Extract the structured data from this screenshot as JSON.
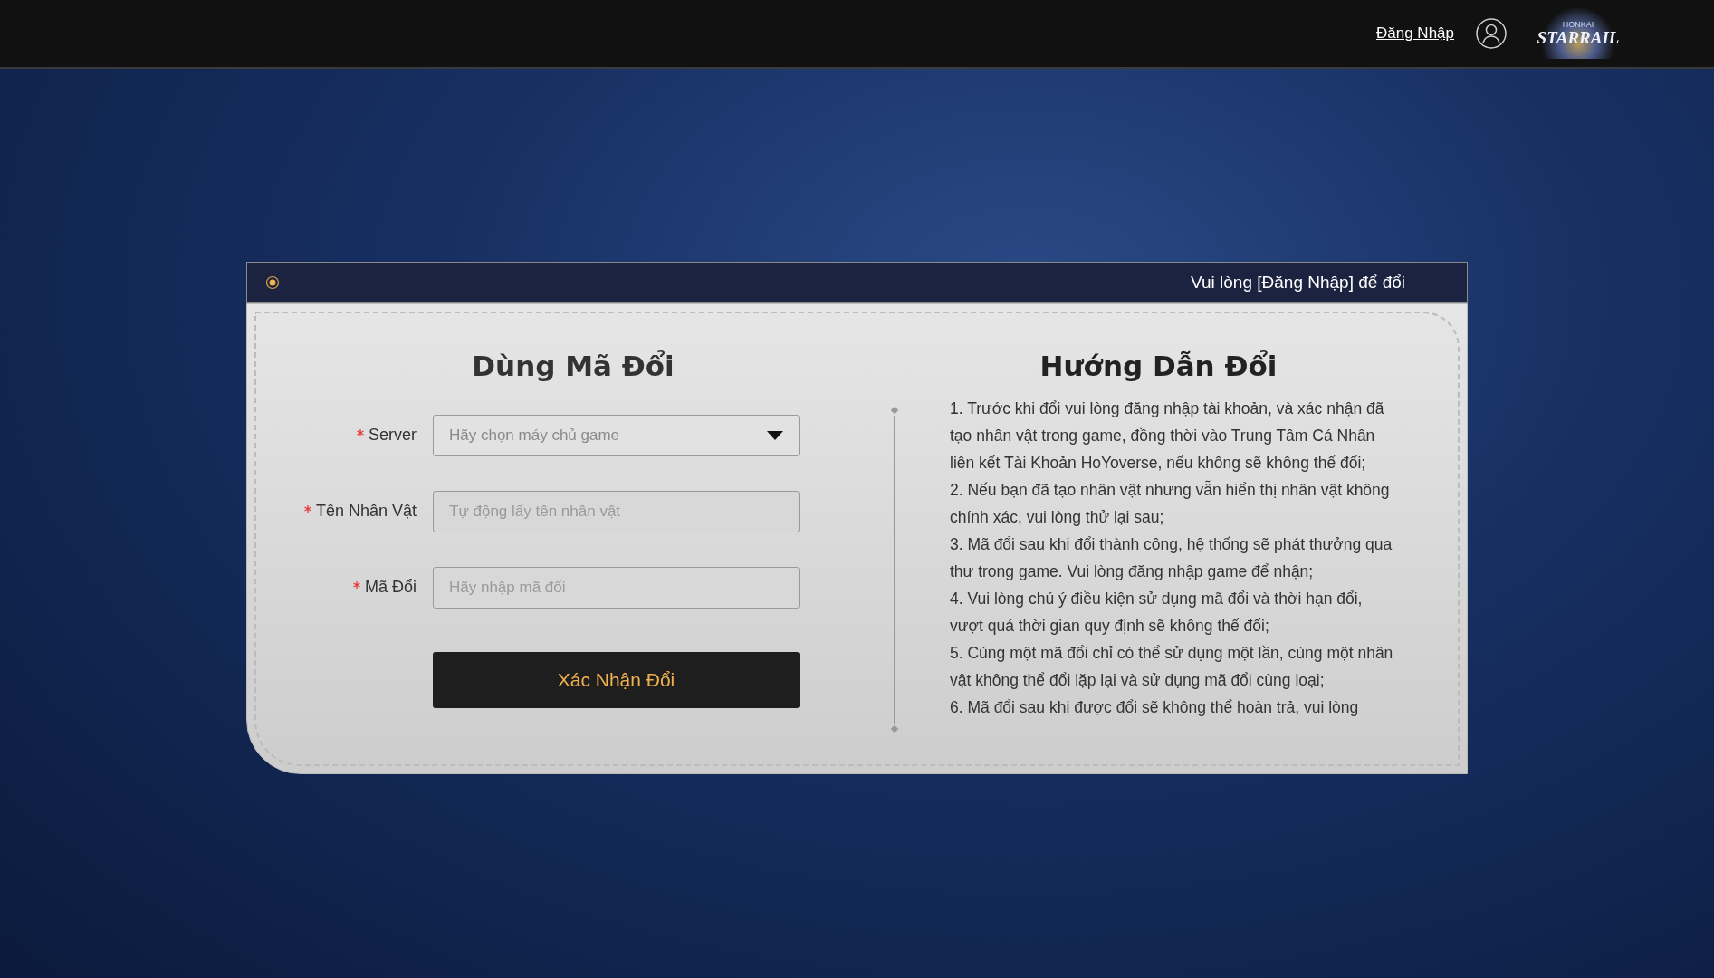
{
  "top_bar": {
    "login_link": "Đăng Nhập",
    "logo": {
      "small": "HONKAI",
      "main": "STARRAIL"
    }
  },
  "card": {
    "notice": "Vui lòng [Đăng Nhập] để đổi",
    "form": {
      "title": "Dùng Mã Đổi",
      "fields": [
        {
          "kind": "select",
          "label": "Server",
          "required": true,
          "placeholder": "Hãy chọn máy chủ game"
        },
        {
          "kind": "text",
          "label": "Tên Nhân Vật",
          "required": true,
          "placeholder": "Tự động lấy tên nhân vật"
        },
        {
          "kind": "text",
          "label": "Mã Đổi",
          "required": true,
          "placeholder": "Hãy nhập mã đổi"
        }
      ],
      "submit": "Xác Nhận Đổi"
    },
    "guide": {
      "title": "Hướng Dẫn Đổi",
      "items": [
        "1. Trước khi đổi vui lòng đăng nhập tài khoản, và xác nhận đã tạo nhân vật trong game, đồng thời vào Trung Tâm Cá Nhân liên kết Tài Khoản HoYoverse, nếu không sẽ không thể đổi;",
        "2. Nếu bạn đã tạo nhân vật nhưng vẫn hiển thị nhân vật không chính xác, vui lòng thử lại sau;",
        "3. Mã đổi sau khi đổi thành công, hệ thống sẽ phát thưởng qua thư trong game. Vui lòng đăng nhập game để nhận;",
        "4. Vui lòng chú ý điều kiện sử dụng mã đổi và thời hạn đổi, vượt quá thời gian quy định sẽ không thể đổi;",
        "5. Cùng một mã đổi chỉ có thể sử dụng một lần, cùng một nhân vật không thể đổi lặp lại và sử dụng mã đổi cùng loại;",
        "6. Mã đổi sau khi được đổi sẽ không thể hoàn trả, vui lòng"
      ]
    }
  }
}
